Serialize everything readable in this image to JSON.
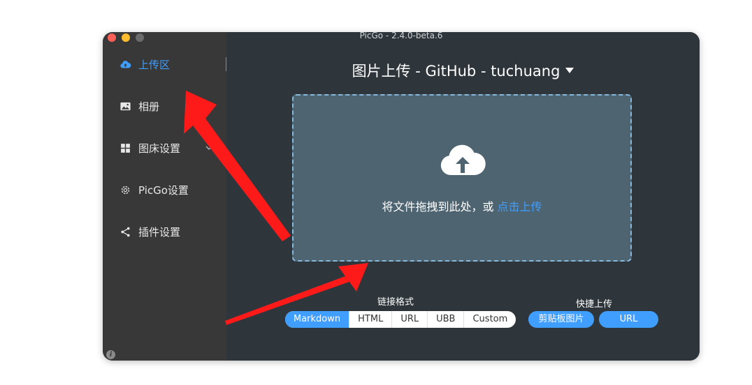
{
  "window": {
    "title": "PicGo - 2.4.0-beta.6"
  },
  "sidebar": {
    "items": [
      {
        "label": "上传区",
        "icon": "upload-cloud-icon",
        "active": true
      },
      {
        "label": "相册",
        "icon": "image-icon"
      },
      {
        "label": "图床设置",
        "icon": "grid-icon",
        "expandable": true
      },
      {
        "label": "PicGo设置",
        "icon": "gear-icon"
      },
      {
        "label": "插件设置",
        "icon": "share-icon"
      }
    ]
  },
  "main": {
    "title": "图片上传 - GitHub - tuchuang",
    "dropzone": {
      "text": "将文件拖拽到此处，或 ",
      "link": "点击上传"
    },
    "link_format": {
      "label": "链接格式",
      "options": [
        "Markdown",
        "HTML",
        "URL",
        "UBB",
        "Custom"
      ],
      "selected": "Markdown"
    },
    "quick_upload": {
      "label": "快捷上传",
      "clipboard_button": "剪贴板图片",
      "url_button": "URL"
    }
  },
  "colors": {
    "accent": "#409eff",
    "sidebar_bg": "#383838",
    "main_bg": "#2e363b",
    "dropzone_bg": "#4e6470",
    "annotation_arrow": "#ff1a1a"
  }
}
